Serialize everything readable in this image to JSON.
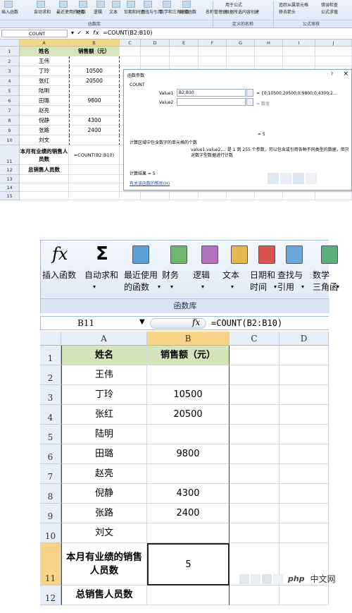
{
  "top": {
    "ribbon": {
      "buttons": [
        "插入函数",
        "自动求和",
        "最近使用的函数",
        "财务",
        "逻辑",
        "文本",
        "日期和时间",
        "查找与引用",
        "数学和三角函数",
        "其他函数",
        "名称管理器"
      ],
      "right_items": [
        "用于公式",
        "根据所选内容创建",
        "追踪从属单元格",
        "移去箭头",
        "错误检查",
        "公式求值"
      ],
      "groups": [
        "函数库",
        "定义的名称",
        "公式审核"
      ]
    },
    "name_box": "COUNT",
    "formula": "=COUNT(B2:B10)",
    "columns": [
      "A",
      "B",
      "C",
      "D",
      "E",
      "F",
      "G",
      "H",
      "I",
      "J"
    ],
    "rows": [
      {
        "n": "1",
        "a": "姓名",
        "b": "销售额（元）"
      },
      {
        "n": "2",
        "a": "王伟",
        "b": ""
      },
      {
        "n": "3",
        "a": "丁玲",
        "b": "10500"
      },
      {
        "n": "4",
        "a": "张红",
        "b": "20500"
      },
      {
        "n": "5",
        "a": "陆明",
        "b": ""
      },
      {
        "n": "6",
        "a": "田璐",
        "b": "9800"
      },
      {
        "n": "7",
        "a": "赵亮",
        "b": ""
      },
      {
        "n": "8",
        "a": "倪静",
        "b": "4300"
      },
      {
        "n": "9",
        "a": "张路",
        "b": "2400"
      },
      {
        "n": "10",
        "a": "刘文",
        "b": ""
      },
      {
        "n": "11",
        "a": "本月有业绩的销售人员数",
        "b": "=COUNT(B2:B10)"
      },
      {
        "n": "12",
        "a": "总销售人员数",
        "b": ""
      },
      {
        "n": "13",
        "a": "",
        "b": ""
      },
      {
        "n": "14",
        "a": "",
        "b": ""
      },
      {
        "n": "15",
        "a": "",
        "b": ""
      }
    ],
    "dialog": {
      "title": "函数参数",
      "help": "?",
      "close": "×",
      "func": "COUNT",
      "value1_label": "Value1",
      "value1": "B2:B10",
      "value1_result": "= {0;10500;20500;0;9800;0;4300;2…",
      "value2_label": "Value2",
      "value2_result": "= 数值",
      "equals_result": "= 5",
      "desc": "计算区域中包含数字的单元格的个数",
      "param_desc": "value1,value2,... 是 1 到 255 个参数，可以包含或引用各种不同类型的数据，但只对数字型数据进行计数",
      "calc_result": "计算结果 = 5",
      "help_link": "有关该函数的帮助(H)"
    }
  },
  "bottom": {
    "ribbon": {
      "buttons": [
        {
          "l1": "插入函数",
          "l2": ""
        },
        {
          "l1": "自动求和",
          "l2": ""
        },
        {
          "l1": "最近使用",
          "l2": "的函数"
        },
        {
          "l1": "财务",
          "l2": ""
        },
        {
          "l1": "逻辑",
          "l2": ""
        },
        {
          "l1": "文本",
          "l2": ""
        },
        {
          "l1": "日期和",
          "l2": "时间"
        },
        {
          "l1": "查找与",
          "l2": "引用"
        },
        {
          "l1": "数学",
          "l2": "三角函"
        }
      ],
      "group_label": "函数库",
      "fx": "fx",
      "sigma": "Σ"
    },
    "name_box": "B11",
    "formula": "=COUNT(B2:B10)",
    "columns": [
      "A",
      "B",
      "C",
      "D"
    ],
    "rows": [
      {
        "n": "1",
        "a": "姓名",
        "b": "销售额（元）"
      },
      {
        "n": "2",
        "a": "王伟",
        "b": ""
      },
      {
        "n": "3",
        "a": "丁玲",
        "b": "10500"
      },
      {
        "n": "4",
        "a": "张红",
        "b": "20500"
      },
      {
        "n": "5",
        "a": "陆明",
        "b": ""
      },
      {
        "n": "6",
        "a": "田璐",
        "b": "9800"
      },
      {
        "n": "7",
        "a": "赵亮",
        "b": ""
      },
      {
        "n": "8",
        "a": "倪静",
        "b": "4300"
      },
      {
        "n": "9",
        "a": "张路",
        "b": "2400"
      },
      {
        "n": "10",
        "a": "刘文",
        "b": ""
      },
      {
        "n": "11",
        "a": "本月有业绩的销售人员数",
        "b": "5"
      },
      {
        "n": "12",
        "a": "总销售人员数",
        "b": ""
      }
    ]
  },
  "watermark": "中文网",
  "watermark_brand": "php",
  "colors": {
    "header_fill": "#d6e4bc",
    "active_header": "#f8d48a",
    "ribbon": "#dde7f3"
  }
}
